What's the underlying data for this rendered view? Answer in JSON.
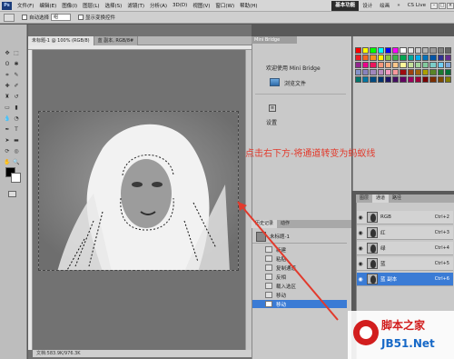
{
  "app": {
    "logo": "Ps"
  },
  "menubar": {
    "items": [
      "文件(F)",
      "编辑(E)",
      "图像(I)",
      "图层(L)",
      "选择(S)",
      "滤镜(T)",
      "分析(A)",
      "3D(D)",
      "视图(V)",
      "窗口(W)",
      "帮助(H)"
    ],
    "zoom": "100%",
    "workspaces": [
      "基本功能",
      "设计",
      "绘画",
      "»"
    ],
    "active_workspace": "基本功能",
    "cs_live": "CS Live"
  },
  "optionsbar": {
    "auto_select": "自动选择",
    "auto_select_value": "组",
    "show_transform": "显示变换控件"
  },
  "document": {
    "tabs": [
      "未标题-1 @ 100% (RGB/8)",
      "蓝 副本, RGB/8#"
    ],
    "status": "文档:583.9K/976.3K"
  },
  "mini_bridge": {
    "tab": "Mini Bridge",
    "welcome": "欢迎使用 Mini Bridge",
    "browse": "浏览文件",
    "settings": "设置"
  },
  "swatches": {
    "colors": [
      "#ff0000",
      "#ffff00",
      "#00ff00",
      "#00ffff",
      "#0000ff",
      "#ff00ff",
      "#ffffff",
      "#e6e6e6",
      "#cccccc",
      "#b3b3b3",
      "#999999",
      "#808080",
      "#666666",
      "#ed1c24",
      "#f26522",
      "#f7941d",
      "#fff200",
      "#8dc63f",
      "#39b54a",
      "#00a651",
      "#00a99d",
      "#00aeef",
      "#0072bc",
      "#0054a6",
      "#2e3192",
      "#662d91",
      "#92278f",
      "#ec008c",
      "#ed145b",
      "#f7977a",
      "#f9ad81",
      "#fdc68a",
      "#fff79a",
      "#c4df9b",
      "#a3d39c",
      "#82ca9d",
      "#7bcdc8",
      "#6ecff6",
      "#7ea7d8",
      "#8493ca",
      "#8882be",
      "#a187be",
      "#bc8dbf",
      "#f49ac2",
      "#f6989d",
      "#9e0b0f",
      "#a0410d",
      "#a36209",
      "#aba000",
      "#598527",
      "#1a7b30",
      "#007236",
      "#00746b",
      "#0076a3",
      "#004a80",
      "#003471",
      "#1b1464",
      "#440e62",
      "#630460",
      "#9e005d",
      "#9e0039",
      "#790000",
      "#7b2e00",
      "#7d4900",
      "#827b00"
    ],
    "tabs": [
      "颜色",
      "色板",
      "样式"
    ]
  },
  "channels": {
    "tabs": [
      "图层",
      "通道",
      "路径"
    ],
    "rows": [
      {
        "name": "RGB",
        "key": "Ctrl+2"
      },
      {
        "name": "红",
        "key": "Ctrl+3"
      },
      {
        "name": "绿",
        "key": "Ctrl+4"
      },
      {
        "name": "蓝",
        "key": "Ctrl+5"
      },
      {
        "name": "蓝 副本",
        "key": "Ctrl+6"
      }
    ]
  },
  "history": {
    "tabs": [
      "历史记录",
      "动作"
    ],
    "snapshot": "未标题-1",
    "steps": [
      "新建",
      "粘贴",
      "复制通道",
      "反相",
      "载入选区",
      "移动",
      "移动"
    ]
  },
  "annotation": "点击右下方-将通道转变为蚂蚁线",
  "watermark": {
    "text": "脚本之家",
    "site": "JB51.Net"
  }
}
